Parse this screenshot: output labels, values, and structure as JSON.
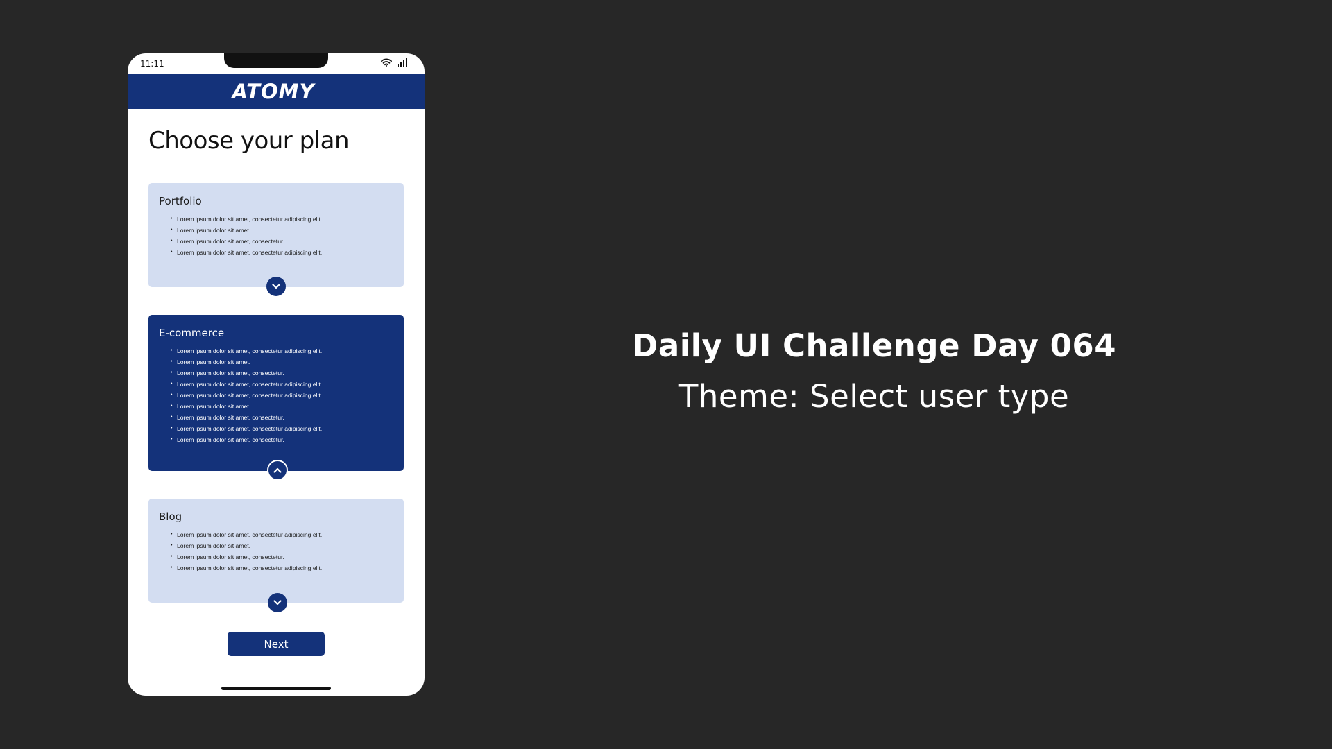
{
  "status_bar": {
    "time": "11:11"
  },
  "header": {
    "brand": "ATOMY"
  },
  "page": {
    "title": "Choose your plan"
  },
  "plans": [
    {
      "title": "Portfolio",
      "items": [
        "Lorem ipsum dolor sit amet, consectetur adipiscing elit.",
        "Lorem ipsum dolor sit amet.",
        "Lorem ipsum dolor sit amet, consectetur.",
        "Lorem ipsum dolor sit amet, consectetur adipiscing elit."
      ],
      "expanded": false
    },
    {
      "title": "E-commerce",
      "items": [
        "Lorem ipsum dolor sit amet, consectetur adipiscing elit.",
        "Lorem ipsum dolor sit amet.",
        "Lorem ipsum dolor sit amet, consectetur.",
        "Lorem ipsum dolor sit amet, consectetur adipiscing elit.",
        "Lorem ipsum dolor sit amet, consectetur adipiscing elit.",
        "Lorem ipsum dolor sit amet.",
        "Lorem ipsum dolor sit amet, consectetur.",
        "Lorem ipsum dolor sit amet, consectetur adipiscing elit.",
        "Lorem ipsum dolor sit amet, consectetur."
      ],
      "expanded": true,
      "selected": true
    },
    {
      "title": "Blog",
      "items": [
        "Lorem ipsum dolor sit amet, consectetur adipiscing elit.",
        "Lorem ipsum dolor sit amet.",
        "Lorem ipsum dolor sit amet, consectetur.",
        "Lorem ipsum dolor sit amet, consectetur adipiscing elit."
      ],
      "expanded": false
    }
  ],
  "actions": {
    "next_label": "Next"
  },
  "challenge": {
    "title": "Daily UI Challenge Day 064",
    "theme": "Theme: Select user type"
  },
  "colors": {
    "background": "#272727",
    "brand": "#14327a",
    "card_light": "#d3ddf1",
    "surface": "#ffffff"
  },
  "icons": {
    "wifi": "wifi-icon",
    "signal": "signal-icon",
    "expand": "chevron-down-icon",
    "collapse": "chevron-up-icon"
  }
}
